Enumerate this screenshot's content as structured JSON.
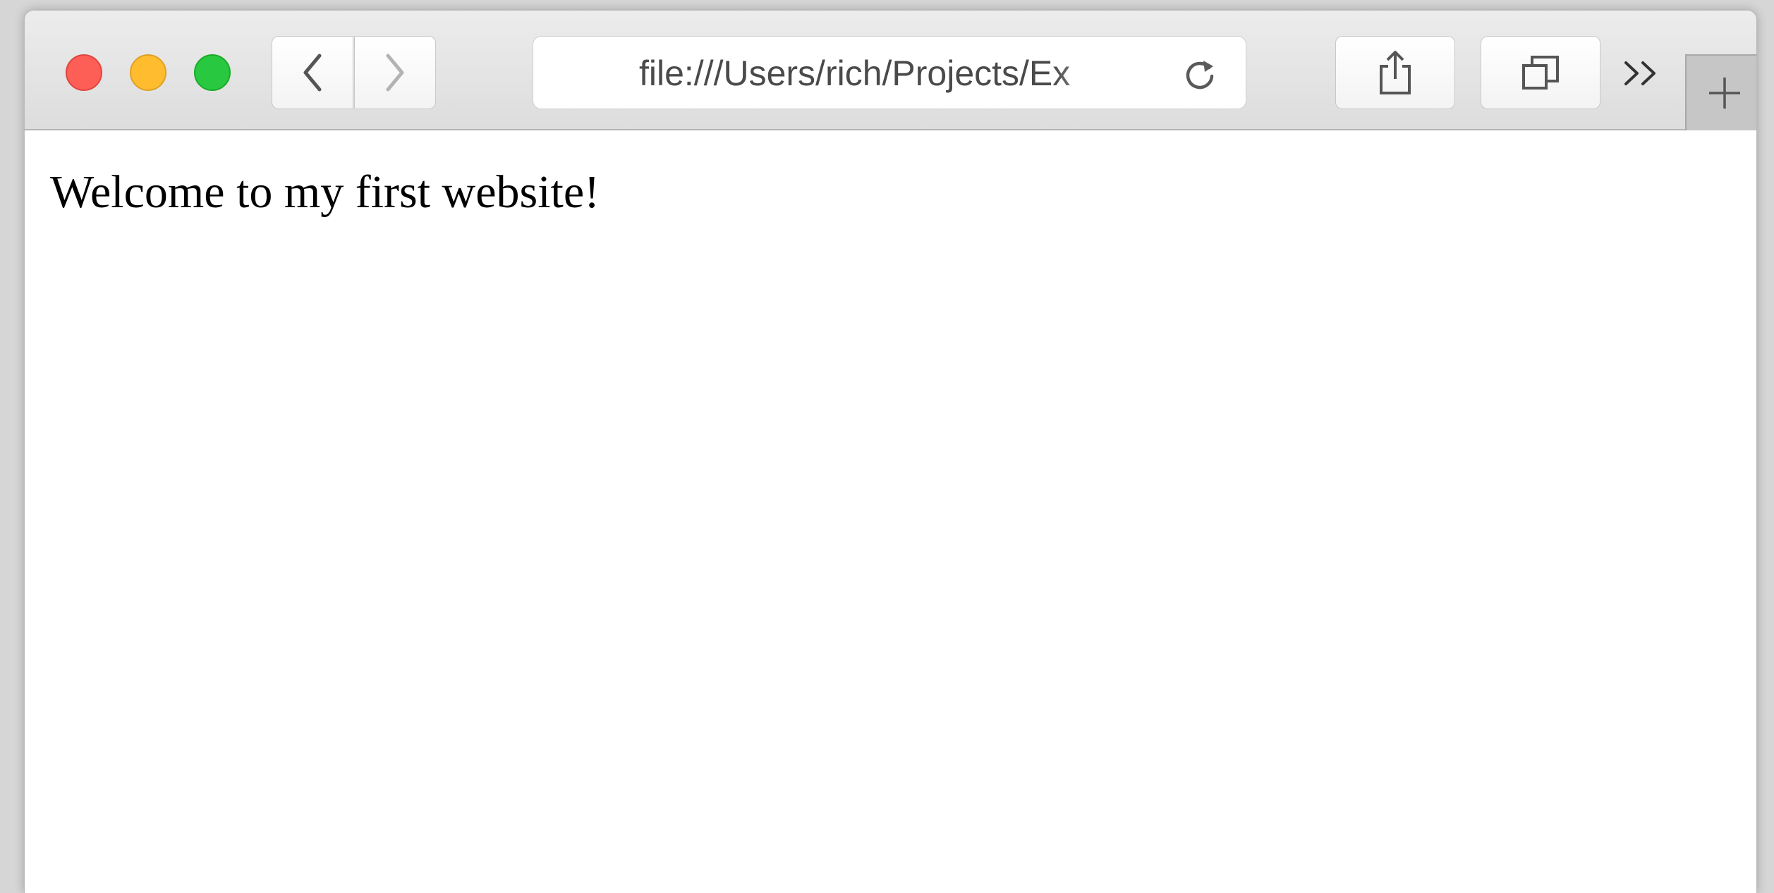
{
  "window": {
    "controls": [
      "close",
      "minimize",
      "zoom"
    ]
  },
  "toolbar": {
    "back_icon": "chevron-left-icon",
    "forward_icon": "chevron-right-icon",
    "share_icon": "share-icon",
    "tabs_icon": "tab-overview-icon",
    "overflow_icon": "double-chevron-right-icon",
    "new_tab_icon": "plus-icon"
  },
  "address_bar": {
    "url": "file:///Users/rich/Projects/Ex",
    "reload_icon": "reload-icon"
  },
  "page": {
    "body_text": "Welcome to my first website!"
  },
  "colors": {
    "close": "#fd5f57",
    "minimize": "#febc2e",
    "zoom": "#28c840"
  }
}
